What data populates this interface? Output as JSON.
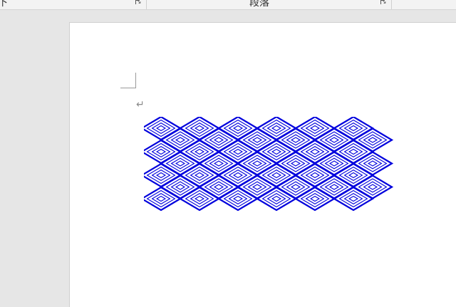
{
  "ribbon": {
    "group_left_label": "下",
    "group_paragraph_label": "段落",
    "launcher_icon": "dialog-launcher-icon"
  },
  "document": {
    "paragraph_mark": "↵"
  },
  "pattern": {
    "stroke_color": "#0000dd",
    "rows": 4,
    "columns": 6,
    "nested_levels": 4
  }
}
